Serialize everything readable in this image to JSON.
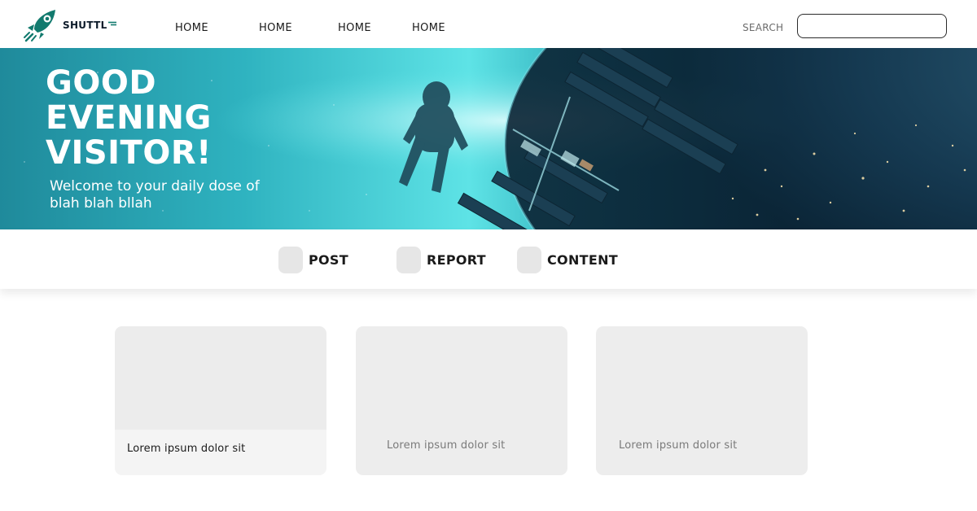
{
  "brand": {
    "name": "SHUTTL",
    "accent": "#127a6e"
  },
  "nav": {
    "items": [
      {
        "label": "HOME"
      },
      {
        "label": "HOME"
      },
      {
        "label": "HOME"
      },
      {
        "label": "HOME"
      }
    ]
  },
  "search": {
    "label": "SEARCH",
    "value": "",
    "placeholder": ""
  },
  "hero": {
    "title": "GOOD\nEVENING\nVISITOR!",
    "subtitle": "Welcome to your daily dose of blah blah bllah"
  },
  "tabs": [
    {
      "label": "POST",
      "icon": "post-icon"
    },
    {
      "label": "REPORT",
      "icon": "report-icon"
    },
    {
      "label": "CONTENT",
      "icon": "content-icon"
    }
  ],
  "cards": [
    {
      "caption": "Lorem ipsum dolor sit"
    },
    {
      "caption": "Lorem ipsum dolor sit"
    },
    {
      "caption": "Lorem ipsum dolor sit"
    }
  ]
}
